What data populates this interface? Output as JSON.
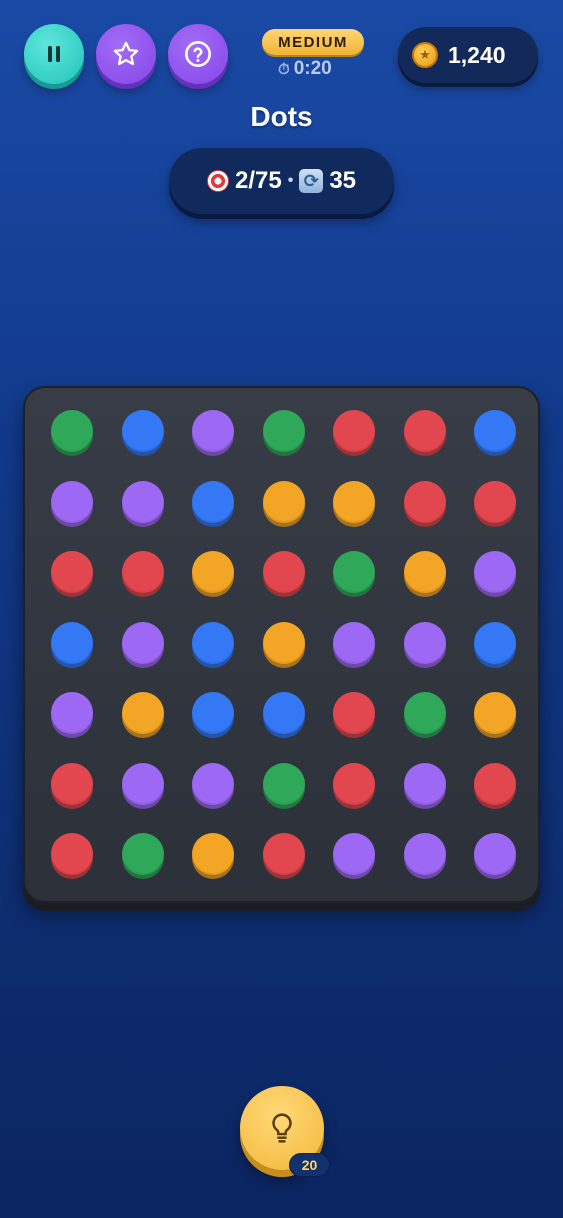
{
  "header": {
    "difficulty": "MEDIUM",
    "timer": "0:20",
    "timer_icon": "stopwatch-icon",
    "coins": "1,240",
    "buttons": [
      "pause-icon",
      "star-icon",
      "help-icon"
    ]
  },
  "game": {
    "title": "Dots",
    "progress": "2/75",
    "separator": "•",
    "moves": "35"
  },
  "colors": {
    "G": "#2fa85a",
    "B": "#3478f5",
    "P": "#9d68f3",
    "R": "#e2474f",
    "O": "#f3a525"
  },
  "board": {
    "rows": [
      [
        "G",
        "B",
        "P",
        "G",
        "R",
        "R",
        "B"
      ],
      [
        "P",
        "P",
        "B",
        "O",
        "O",
        "R",
        "R"
      ],
      [
        "R",
        "R",
        "O",
        "R",
        "G",
        "O",
        "P"
      ],
      [
        "B",
        "P",
        "B",
        "O",
        "P",
        "P",
        "B"
      ],
      [
        "P",
        "O",
        "B",
        "B",
        "R",
        "G",
        "O"
      ],
      [
        "R",
        "P",
        "P",
        "G",
        "R",
        "P",
        "R"
      ],
      [
        "R",
        "G",
        "O",
        "R",
        "P",
        "P",
        "P"
      ]
    ]
  },
  "hint": {
    "count": "20",
    "icon": "lightbulb-icon"
  }
}
